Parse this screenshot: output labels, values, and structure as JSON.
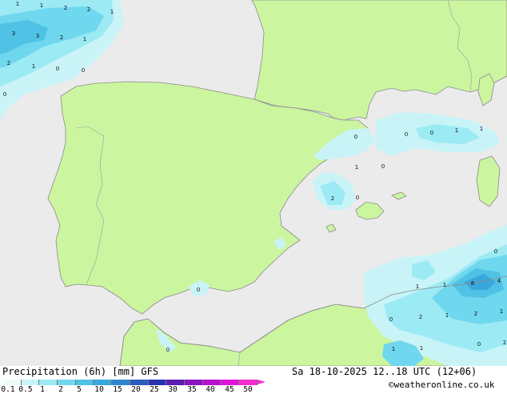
{
  "legend": {
    "title": "Precipitation (6h) [mm] GFS",
    "tick_labels": [
      "0.1",
      "0.5",
      "1",
      "2",
      "5",
      "10",
      "15",
      "20",
      "25",
      "30",
      "35",
      "40",
      "45",
      "50"
    ],
    "colors": [
      "#eefbfb",
      "#c8f4f8",
      "#9ceaf4",
      "#6fd7ee",
      "#4fc2e6",
      "#3aa7dc",
      "#2f86d0",
      "#2a5cc0",
      "#2632ae",
      "#5a1bb0",
      "#8a12c0",
      "#b80ed0",
      "#e014d8",
      "#f42cd0"
    ]
  },
  "timestamp": "Sa 18-10-2025 12..18 UTC (12+06)",
  "credit": "©weatheronline.co.uk",
  "map": {
    "land_color": "#ccf5a0",
    "sea_color": "#ebebeb",
    "coast_color": "#8a8a8a",
    "precip_labels": [
      "1",
      "1",
      "2",
      "2",
      "1",
      "3",
      "3",
      "2",
      "1",
      "2",
      "1",
      "0",
      "0",
      "0",
      "0",
      "0",
      "0",
      "1",
      "1",
      "1",
      "0",
      "2",
      "0",
      "0",
      "0",
      "1",
      "1",
      "8",
      "4",
      "0",
      "2",
      "1",
      "2",
      "1",
      "1",
      "1",
      "2",
      "0",
      "0"
    ]
  }
}
